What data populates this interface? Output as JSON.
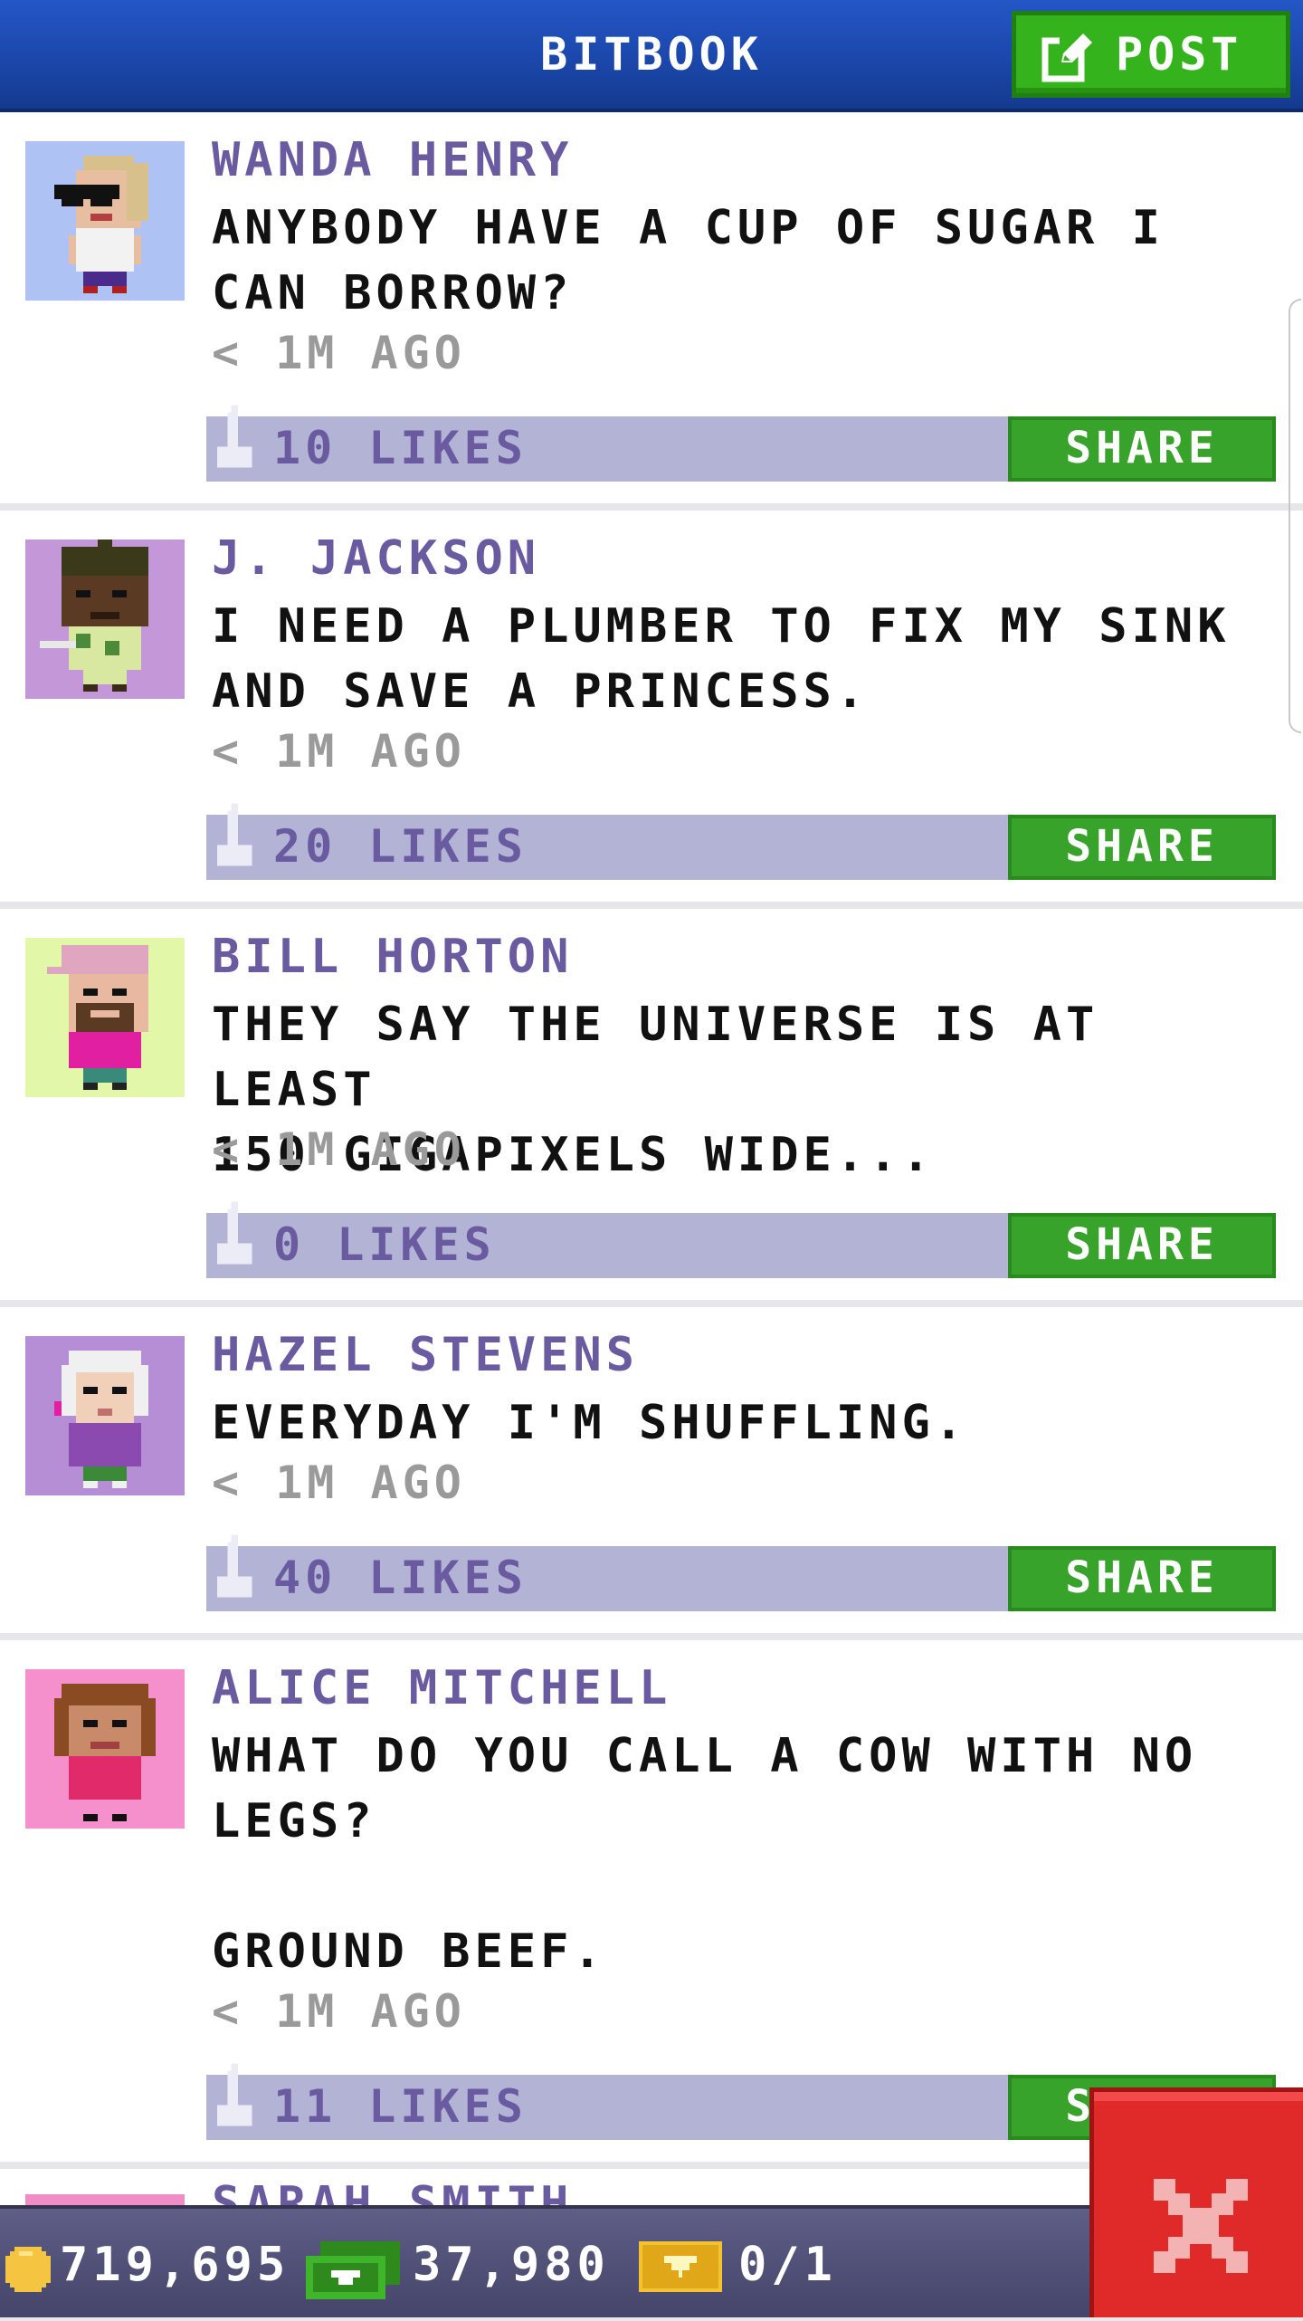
{
  "header": {
    "title": "BITBOOK",
    "post_label": "POST"
  },
  "posts": [
    {
      "author": "WANDA HENRY",
      "message": "ANYBODY HAVE A CUP OF SUGAR I\nCAN BORROW?",
      "time": "< 1M AGO",
      "likes": "10 LIKES",
      "share": "SHARE",
      "avatar_bg": "#aec3f4"
    },
    {
      "author": "J. JACKSON",
      "message": "I NEED A PLUMBER TO FIX MY SINK\nAND SAVE A PRINCESS.",
      "time": "< 1M AGO",
      "likes": "20 LIKES",
      "share": "SHARE",
      "avatar_bg": "#c397d8"
    },
    {
      "author": "BILL HORTON",
      "message": "THEY SAY THE UNIVERSE IS AT LEAST\n150 GIGAPIXELS WIDE...",
      "time": "< 1M AGO",
      "likes": "0 LIKES",
      "share": "SHARE",
      "avatar_bg": "#e3f7a8"
    },
    {
      "author": "HAZEL STEVENS",
      "message": "EVERYDAY I'M SHUFFLING.",
      "time": "< 1M AGO",
      "likes": "40 LIKES",
      "share": "SHARE",
      "avatar_bg": "#b58ed6"
    },
    {
      "author": "ALICE MITCHELL",
      "message": "WHAT DO YOU CALL A COW WITH NO\nLEGS?\n\nGROUND BEEF.",
      "time": "< 1M AGO",
      "likes": "11 LIKES",
      "share": "SHARE",
      "avatar_bg": "#f590cc"
    }
  ],
  "next_post_partial": {
    "author": "SARAH SMITH"
  },
  "status": {
    "coins": "719,695",
    "cash": "37,980",
    "tickets": "0/1"
  },
  "colors": {
    "header_blue": "#1b46a8",
    "post_green": "#34b31d",
    "share_green": "#38a32a",
    "likes_bar": "#b3b3d6",
    "author_purple": "#6a5ba1",
    "close_red": "#e02a2a"
  },
  "icons": {
    "post": "edit-icon",
    "like": "thumbs-up-icon",
    "coin": "coin-icon",
    "cash": "cash-icon",
    "ticket": "ticket-icon",
    "close": "close-icon"
  }
}
